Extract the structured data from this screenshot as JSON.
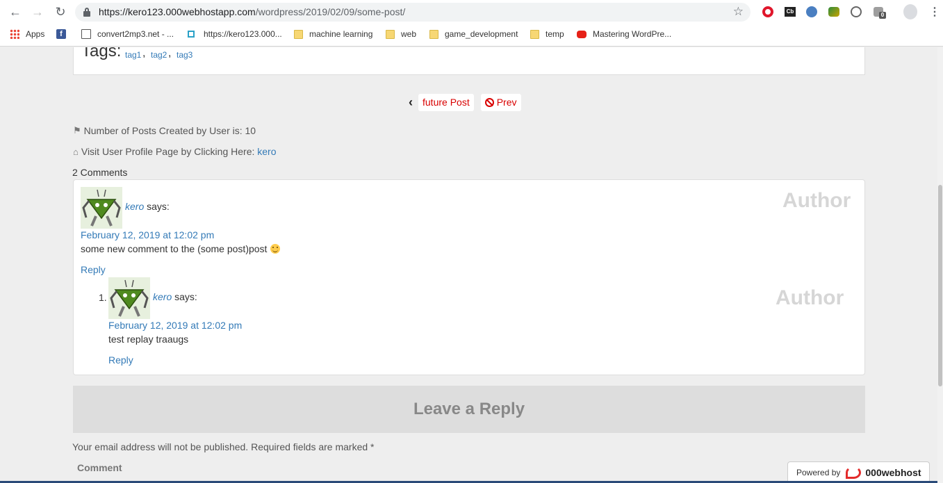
{
  "browser": {
    "url_host": "https://kero123.000webhostapp.com",
    "url_path": "/wordpress/2019/02/09/some-post/",
    "bookmarks": [
      {
        "label": "Apps",
        "icon": "apps-grid-icon"
      },
      {
        "label": "",
        "icon": "facebook-icon"
      },
      {
        "label": "convert2mp3.net - ...",
        "icon": "page-icon"
      },
      {
        "label": "https://kero123.000...",
        "icon": "site-icon"
      },
      {
        "label": "machine learning",
        "icon": "folder-icon"
      },
      {
        "label": "web",
        "icon": "folder-icon"
      },
      {
        "label": "game_development",
        "icon": "folder-icon"
      },
      {
        "label": "temp",
        "icon": "folder-icon"
      },
      {
        "label": "Mastering WordPre...",
        "icon": "youtube-icon"
      }
    ],
    "extension_badge": "0"
  },
  "post": {
    "tags_label": "Tags:",
    "tags": [
      "tag1",
      "tag2",
      "tag3"
    ],
    "tag_separator": ",",
    "nav": {
      "future_label": "future Post",
      "prev_label": "Prev"
    },
    "posts_count_label": "Number of Posts Created by User is: 10",
    "profile_label": "Visit User Profile Page by Clicking Here:",
    "profile_link": "kero",
    "comments_count": "2 Comments"
  },
  "comments": [
    {
      "author": "kero",
      "says": "says:",
      "date": "February 12, 2019 at 12:02 pm",
      "text": "some new comment to the (some post)post",
      "reply": "Reply",
      "badge": "Author"
    },
    {
      "number": "1.",
      "author": "kero",
      "says": "says:",
      "date": "February 12, 2019 at 12:02 pm",
      "text": "test replay traaugs",
      "reply": "Reply",
      "badge": "Author"
    }
  ],
  "reply_form": {
    "title": "Leave a Reply",
    "notice": "Your email address will not be published. Required fields are marked *",
    "comment_label": "Comment"
  },
  "footer": {
    "powered_by": "Powered by",
    "brand": "000webhost"
  },
  "colors": {
    "link": "#337ab7",
    "nav_red": "#d90000",
    "page_bg": "#eeeeee",
    "author_badge": "#d6d6d6"
  }
}
